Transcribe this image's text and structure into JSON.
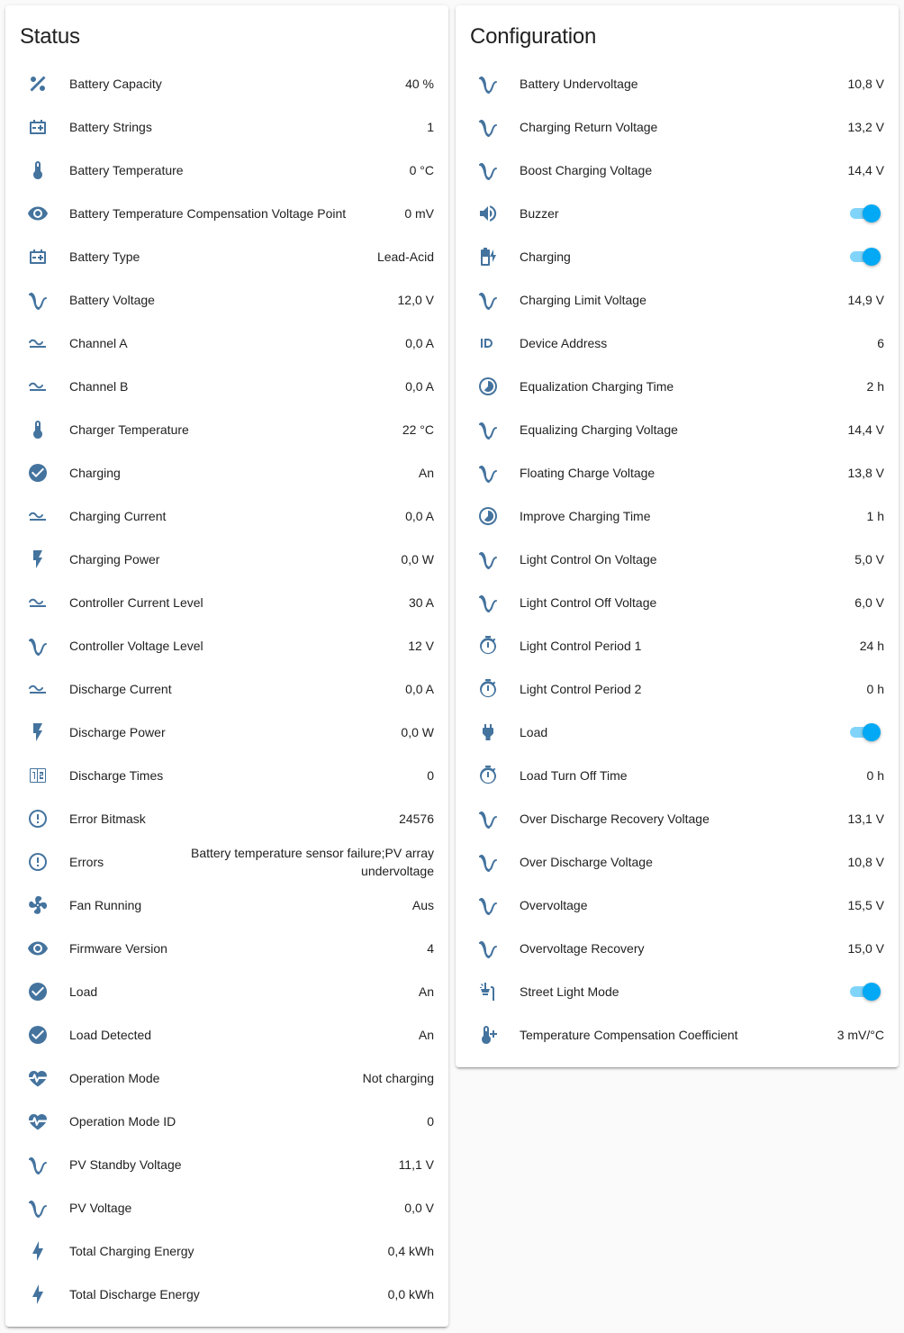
{
  "colors": {
    "icon": "#44739e",
    "toggle_on": "#03a9f4",
    "text": "#212121",
    "background": "#fafafa"
  },
  "status": {
    "title": "Status",
    "rows": [
      {
        "label": "Battery Capacity",
        "value": "40 %",
        "icon": "percent-icon"
      },
      {
        "label": "Battery Strings",
        "value": "1",
        "icon": "battery-icon"
      },
      {
        "label": "Battery Temperature",
        "value": "0 °C",
        "icon": "thermometer-icon"
      },
      {
        "label": "Battery Temperature Compensation Voltage Point",
        "value": "0 mV",
        "icon": "eye-icon"
      },
      {
        "label": "Battery Type",
        "value": "Lead-Acid",
        "icon": "battery-icon"
      },
      {
        "label": "Battery Voltage",
        "value": "12,0 V",
        "icon": "sine-wave-icon"
      },
      {
        "label": "Channel A",
        "value": "0,0 A",
        "icon": "current-icon"
      },
      {
        "label": "Channel B",
        "value": "0,0 A",
        "icon": "current-icon"
      },
      {
        "label": "Charger Temperature",
        "value": "22 °C",
        "icon": "thermometer-icon"
      },
      {
        "label": "Charging",
        "value": "An",
        "icon": "check-circle-icon"
      },
      {
        "label": "Charging Current",
        "value": "0,0 A",
        "icon": "current-icon"
      },
      {
        "label": "Charging Power",
        "value": "0,0 W",
        "icon": "flash-icon"
      },
      {
        "label": "Controller Current Level",
        "value": "30 A",
        "icon": "current-icon"
      },
      {
        "label": "Controller Voltage Level",
        "value": "12 V",
        "icon": "sine-wave-icon"
      },
      {
        "label": "Discharge Current",
        "value": "0,0 A",
        "icon": "current-icon"
      },
      {
        "label": "Discharge Power",
        "value": "0,0 W",
        "icon": "flash-icon"
      },
      {
        "label": "Discharge Times",
        "value": "0",
        "icon": "counter-icon"
      },
      {
        "label": "Error Bitmask",
        "value": "24576",
        "icon": "alert-circle-icon"
      },
      {
        "label": "Errors",
        "value": "Battery temperature sensor failure;PV array undervoltage",
        "icon": "alert-circle-icon",
        "multiline": true
      },
      {
        "label": "Fan Running",
        "value": "Aus",
        "icon": "fan-icon"
      },
      {
        "label": "Firmware Version",
        "value": "4",
        "icon": "eye-icon"
      },
      {
        "label": "Load",
        "value": "An",
        "icon": "check-circle-icon"
      },
      {
        "label": "Load Detected",
        "value": "An",
        "icon": "check-circle-icon"
      },
      {
        "label": "Operation Mode",
        "value": "Not charging",
        "icon": "heart-pulse-icon"
      },
      {
        "label": "Operation Mode ID",
        "value": "0",
        "icon": "heart-pulse-icon"
      },
      {
        "label": "PV Standby Voltage",
        "value": "11,1 V",
        "icon": "sine-wave-icon"
      },
      {
        "label": "PV Voltage",
        "value": "0,0 V",
        "icon": "sine-wave-icon"
      },
      {
        "label": "Total Charging Energy",
        "value": "0,4 kWh",
        "icon": "lightning-icon"
      },
      {
        "label": "Total Discharge Energy",
        "value": "0,0 kWh",
        "icon": "lightning-icon"
      }
    ]
  },
  "configuration": {
    "title": "Configuration",
    "rows": [
      {
        "label": "Battery Undervoltage",
        "value": "10,8 V",
        "icon": "sine-wave-icon"
      },
      {
        "label": "Charging Return Voltage",
        "value": "13,2 V",
        "icon": "sine-wave-icon"
      },
      {
        "label": "Boost Charging Voltage",
        "value": "14,4 V",
        "icon": "sine-wave-icon"
      },
      {
        "label": "Buzzer",
        "toggle": true,
        "state": "on",
        "icon": "volume-icon"
      },
      {
        "label": "Charging",
        "toggle": true,
        "state": "on",
        "icon": "battery-charging-icon"
      },
      {
        "label": "Charging Limit Voltage",
        "value": "14,9 V",
        "icon": "sine-wave-icon"
      },
      {
        "label": "Device Address",
        "value": "6",
        "icon": "id-icon"
      },
      {
        "label": "Equalization Charging Time",
        "value": "2 h",
        "icon": "clock-circle-icon"
      },
      {
        "label": "Equalizing Charging Voltage",
        "value": "14,4 V",
        "icon": "sine-wave-icon"
      },
      {
        "label": "Floating Charge Voltage",
        "value": "13,8 V",
        "icon": "sine-wave-icon"
      },
      {
        "label": "Improve Charging Time",
        "value": "1 h",
        "icon": "clock-circle-icon"
      },
      {
        "label": "Light Control On Voltage",
        "value": "5,0 V",
        "icon": "sine-wave-icon"
      },
      {
        "label": "Light Control Off Voltage",
        "value": "6,0 V",
        "icon": "sine-wave-icon"
      },
      {
        "label": "Light Control Period 1",
        "value": "24 h",
        "icon": "timer-icon"
      },
      {
        "label": "Light Control Period 2",
        "value": "0 h",
        "icon": "timer-icon"
      },
      {
        "label": "Load",
        "toggle": true,
        "state": "on",
        "icon": "plug-icon"
      },
      {
        "label": "Load Turn Off Time",
        "value": "0 h",
        "icon": "timer-icon"
      },
      {
        "label": "Over Discharge Recovery Voltage",
        "value": "13,1 V",
        "icon": "sine-wave-icon"
      },
      {
        "label": "Over Discharge Voltage",
        "value": "10,8 V",
        "icon": "sine-wave-icon"
      },
      {
        "label": "Overvoltage",
        "value": "15,5 V",
        "icon": "sine-wave-icon"
      },
      {
        "label": "Overvoltage Recovery",
        "value": "15,0 V",
        "icon": "sine-wave-icon"
      },
      {
        "label": "Street Light Mode",
        "toggle": true,
        "state": "on",
        "icon": "street-light-icon"
      },
      {
        "label": "Temperature Compensation Coefficient",
        "value": "3 mV/°C",
        "icon": "thermometer-plus-icon"
      }
    ]
  }
}
